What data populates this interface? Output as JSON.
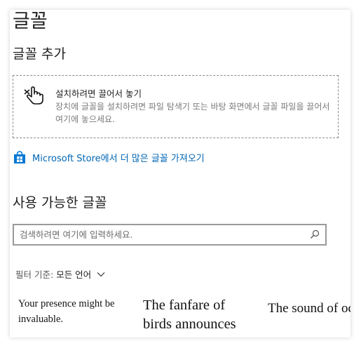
{
  "page": {
    "title": "글꼴"
  },
  "add_fonts": {
    "heading": "글꼴 추가",
    "drop_title": "설치하려면 끌어서 놓기",
    "drop_description": "장치에 글꼴을 설치하려면 파일 탐색기 또는 바탕 화면에서 글꼴 파일을 끌어서 여기에 놓으세요.",
    "store_link": "Microsoft Store에서 더 많은 글꼴 가져오기"
  },
  "available_fonts": {
    "heading": "사용 가능한 글꼴",
    "search_placeholder": "검색하려면 여기에 입력하세요.",
    "filter_label": "필터 기준:",
    "filter_value": "모든 언어",
    "previews": [
      "Your presence might be invaluable.",
      "The fanfare of birds announces the morning.",
      "The sound of ocean waves calms my soul."
    ]
  },
  "colors": {
    "accent": "#0066b4",
    "store_icon": "#0078d4",
    "secondary_text": "#7a7a7a"
  },
  "icons": {
    "drop_zone": "hand-pointer-icon",
    "store": "store-bag-icon",
    "search": "search-icon",
    "filter": "chevron-down-icon"
  }
}
